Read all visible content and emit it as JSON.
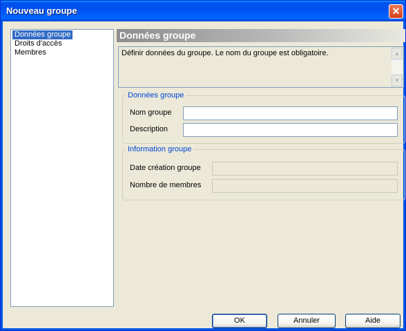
{
  "window": {
    "title": "Nouveau groupe",
    "close_glyph": "✕"
  },
  "nav": {
    "items": [
      {
        "label": "Données groupe",
        "selected": true
      },
      {
        "label": "Droits d'accès",
        "selected": false
      },
      {
        "label": "Membres",
        "selected": false
      }
    ]
  },
  "header": {
    "title": "Données groupe"
  },
  "description": {
    "text": "Définir données du groupe. Le nom du groupe est obligatoire."
  },
  "group_data": {
    "legend": "Données groupe",
    "name_label": "Nom groupe",
    "name_value": "",
    "desc_label": "Description",
    "desc_value": ""
  },
  "group_info": {
    "legend": "Information groupe",
    "created_label": "Date création groupe",
    "created_value": "",
    "members_label": "Nombre de membres",
    "members_value": ""
  },
  "buttons": {
    "ok": "OK",
    "cancel": "Annuler",
    "help": "Aide"
  },
  "icons": {
    "scroll_up": "scroll-up-arrow-icon",
    "scroll_down": "scroll-down-arrow-icon",
    "close": "close-icon"
  },
  "colors": {
    "titlebar": "#0053ee",
    "selection": "#316ac5",
    "legend": "#0046d5",
    "dialog_bg": "#ece9d8"
  }
}
